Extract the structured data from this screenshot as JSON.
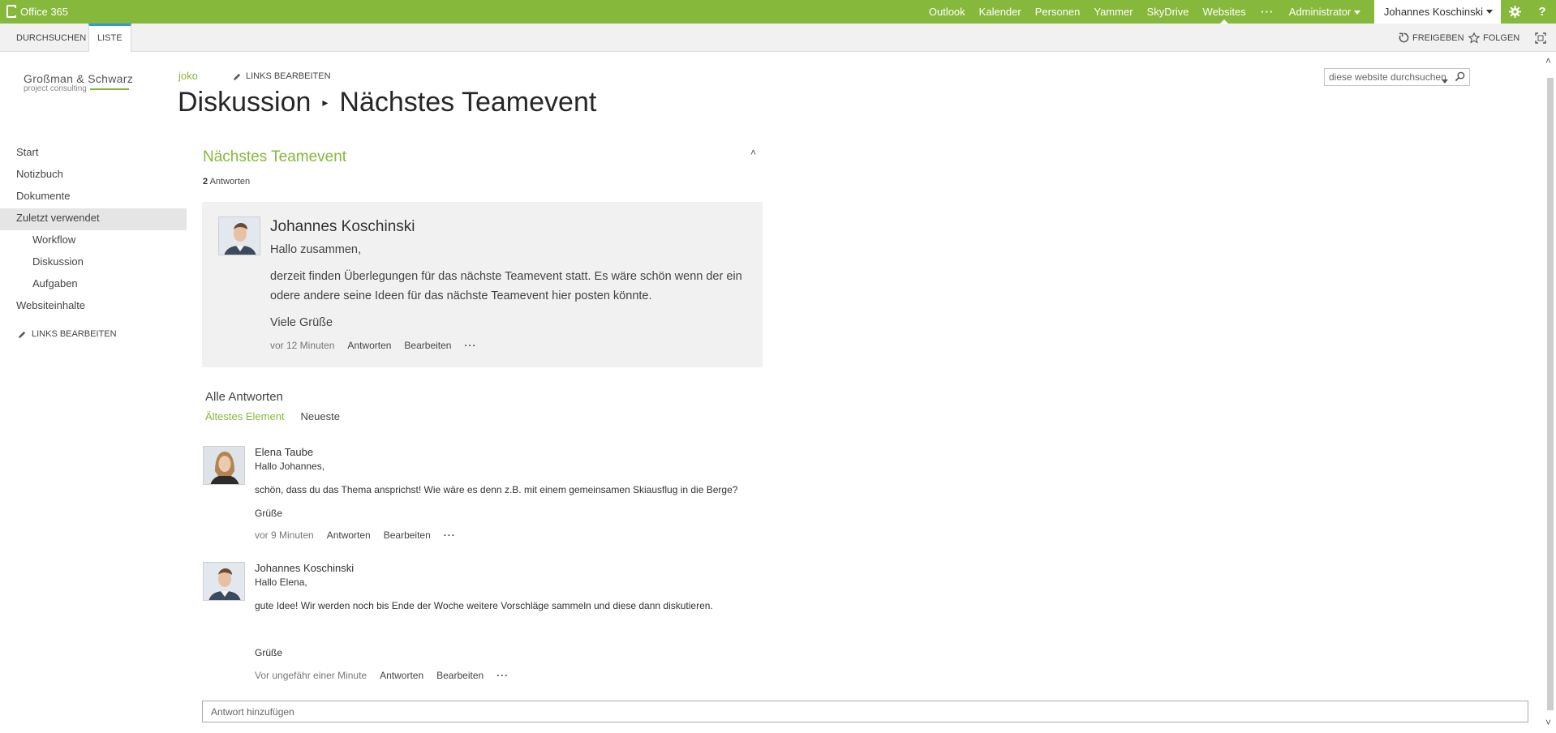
{
  "suite": {
    "brand": "Office 365",
    "nav": [
      "Outlook",
      "Kalender",
      "Personen",
      "Yammer",
      "SkyDrive",
      "Websites"
    ],
    "active_nav": "Websites",
    "more": "···",
    "admin": "Administrator",
    "user": "Johannes Koschinski"
  },
  "ribbon": {
    "tabs": [
      "DURCHSUCHEN",
      "LISTE"
    ],
    "share": "FREIGEBEN",
    "follow": "FOLGEN"
  },
  "logo": {
    "line1": "Großman & Schwarz",
    "line2": "project consulting"
  },
  "header": {
    "breadcrumb_user": "joko",
    "edit_links": "LINKS BEARBEITEN",
    "title_part1": "Diskussion",
    "title_part2": "Nächstes Teamevent"
  },
  "search": {
    "placeholder": "diese website durchsuchen"
  },
  "leftnav": {
    "items": [
      "Start",
      "Notizbuch",
      "Dokumente",
      "Zuletzt verwendet",
      "Workflow",
      "Diskussion",
      "Aufgaben",
      "Websiteinhalte"
    ],
    "edit_links": "LINKS BEARBEITEN"
  },
  "discussion": {
    "title": "Nächstes Teamevent",
    "reply_count": "2",
    "reply_count_label": "Antworten",
    "main_post": {
      "author": "Johannes Koschinski",
      "greeting": "Hallo zusammen,",
      "body": "derzeit finden Überlegungen für das nächste Teamevent statt. Es wäre schön wenn der ein odere andere seine Ideen für das nächste Teamevent hier posten könnte.",
      "closing": "Viele Grüße",
      "time": "vor 12 Minuten",
      "reply": "Antworten",
      "edit": "Bearbeiten",
      "more": "···"
    },
    "all_answers": "Alle Antworten",
    "sort_oldest": "Ältestes Element",
    "sort_newest": "Neueste",
    "replies": [
      {
        "author": "Elena Taube",
        "greeting": "Hallo Johannes,",
        "body": "schön, dass du das Thema ansprichst! Wie wäre es denn z.B. mit einem gemeinsamen Skiausflug in die Berge?",
        "closing": "Grüße",
        "time": "vor 9 Minuten",
        "reply": "Antworten",
        "edit": "Bearbeiten",
        "more": "···"
      },
      {
        "author": "Johannes Koschinski",
        "greeting": "Hallo Elena,",
        "body": "gute Idee! Wir werden noch bis Ende der Woche weitere Vorschläge sammeln und diese dann diskutieren.",
        "closing": "Grüße",
        "time": "Vor ungefähr einer Minute",
        "reply": "Antworten",
        "edit": "Bearbeiten",
        "more": "···"
      }
    ],
    "add_reply_placeholder": "Antwort hinzufügen"
  },
  "colors": {
    "suite_green": "#86b83b",
    "ribbon_tab_accent": "#2f9fd0"
  }
}
